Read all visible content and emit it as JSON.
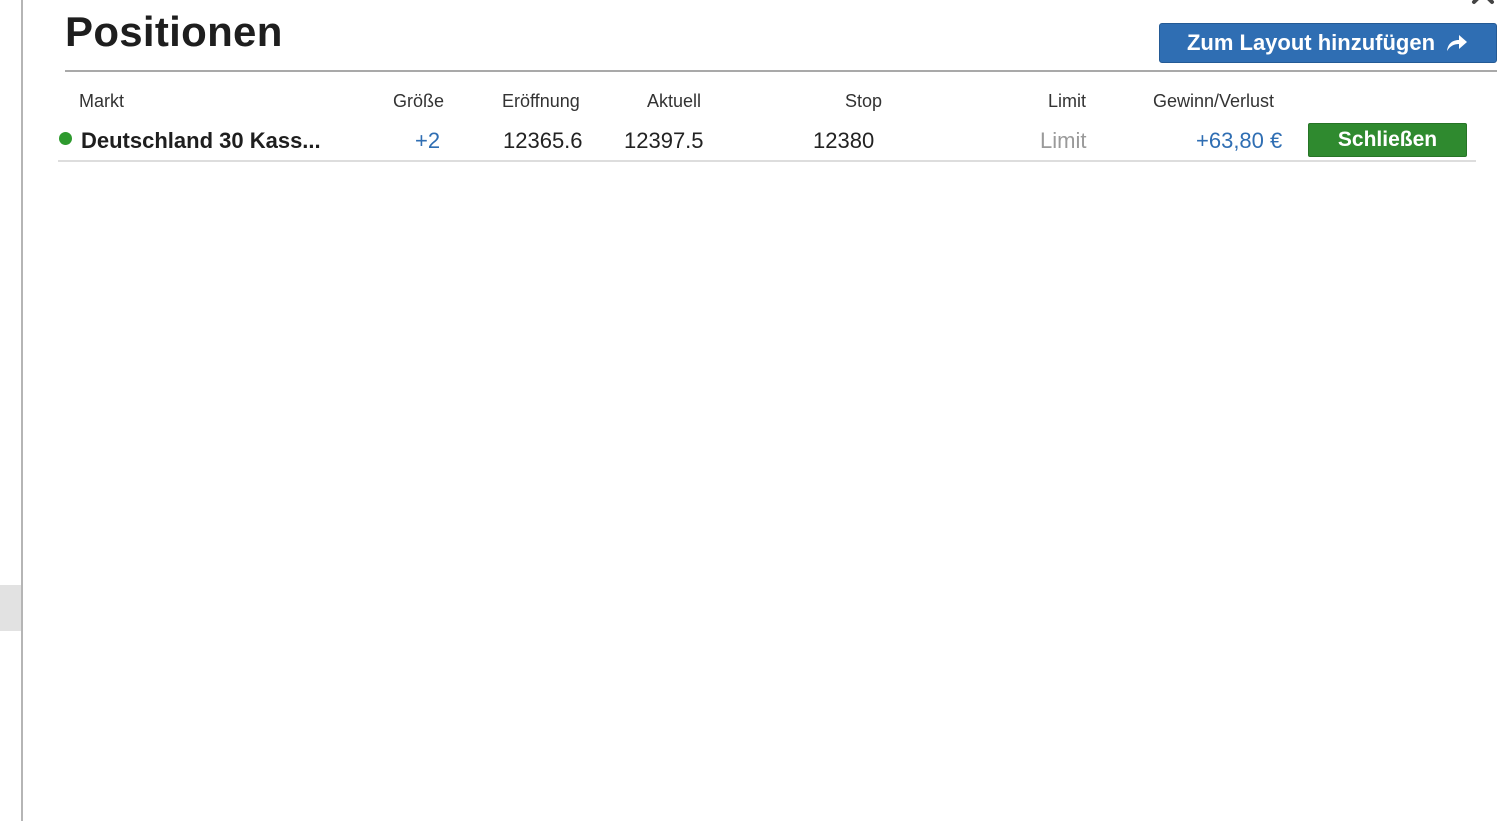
{
  "panel": {
    "title": "Positionen",
    "add_layout_label": "Zum Layout hinzufügen",
    "add_layout_icon": "share-arrow-icon",
    "close_icon": "close-icon"
  },
  "table": {
    "headers": {
      "market": "Markt",
      "size": "Größe",
      "opening": "Eröffnung",
      "current": "Aktuell",
      "stop": "Stop",
      "limit": "Limit",
      "pnl": "Gewinn/Verlust"
    },
    "rows": [
      {
        "status_color": "#2e9a2e",
        "market": "Deutschland 30 Kass...",
        "size": "+2",
        "opening": "12365.6",
        "current": "12397.5",
        "stop": "12380",
        "limit": "Limit",
        "pnl": "+63,80 €",
        "close_label": "Schließen"
      }
    ]
  },
  "colors": {
    "accent_blue": "#2f6eb3",
    "close_green": "#2f8a2f"
  }
}
